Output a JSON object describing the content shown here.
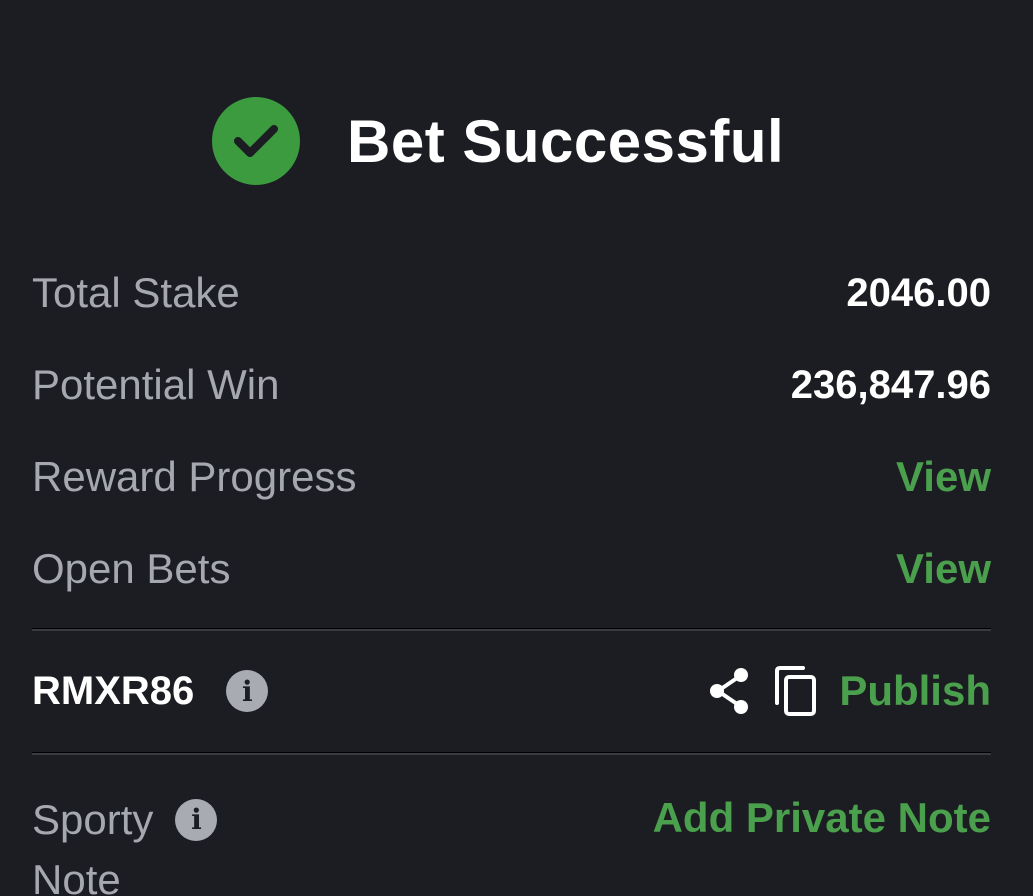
{
  "header": {
    "title": "Bet Successful",
    "icon": "check-circle-icon",
    "accent": "#3c9a3f"
  },
  "summary": {
    "total_stake_label": "Total Stake",
    "total_stake_value": "2046.00",
    "potential_win_label": "Potential Win",
    "potential_win_value": "236,847.96",
    "reward_progress_label": "Reward Progress",
    "reward_progress_action": "View",
    "open_bets_label": "Open Bets",
    "open_bets_action": "View"
  },
  "booking": {
    "code": "RMXR86",
    "info_icon": "info-icon",
    "share_icon": "share-icon",
    "copy_icon": "copy-icon",
    "publish_label": "Publish"
  },
  "note": {
    "label_line1": "Sporty",
    "label_line2": "Note",
    "action": "Add Private Note"
  },
  "colors": {
    "background": "#1c1d22",
    "label": "#a6a8b0",
    "value": "#ffffff",
    "link": "#4aa04c",
    "divider": "#3a3b42"
  }
}
